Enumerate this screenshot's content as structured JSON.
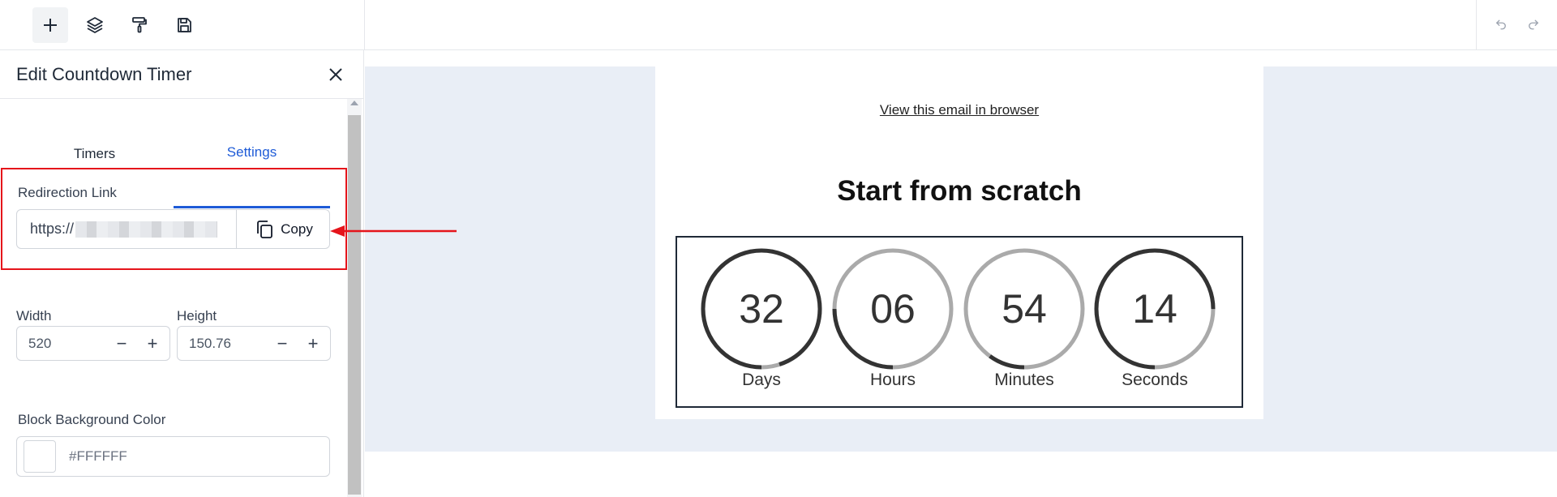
{
  "toolbar": {
    "tools": [
      "add-icon",
      "layers-icon",
      "paint-roller-icon",
      "save-icon"
    ],
    "history": [
      "undo-icon",
      "redo-icon"
    ]
  },
  "panel": {
    "title": "Edit Countdown Timer",
    "tabs": [
      {
        "label": "Timers",
        "active": false
      },
      {
        "label": "Settings",
        "active": true
      }
    ],
    "redirection": {
      "label": "Redirection Link",
      "value": "https://",
      "copy_label": "Copy"
    },
    "width": {
      "label": "Width",
      "value": "520"
    },
    "height": {
      "label": "Height",
      "value": "150.76"
    },
    "background": {
      "label": "Block Background Color",
      "value": "#FFFFFF"
    }
  },
  "email": {
    "view_link": "View this email in browser",
    "heading": "Start from scratch",
    "timer": [
      {
        "value": "32",
        "unit": "Days",
        "progress": 0.95
      },
      {
        "value": "06",
        "unit": "Hours",
        "progress": 0.25
      },
      {
        "value": "54",
        "unit": "Minutes",
        "progress": 0.1
      },
      {
        "value": "14",
        "unit": "Seconds",
        "progress": 0.75
      }
    ]
  },
  "colors": {
    "accent": "#1e5bd7",
    "highlight": "#e5141b",
    "canvas_bg": "#e9eef6",
    "ring_dark": "#333333",
    "ring_light": "#aaaaaa"
  }
}
